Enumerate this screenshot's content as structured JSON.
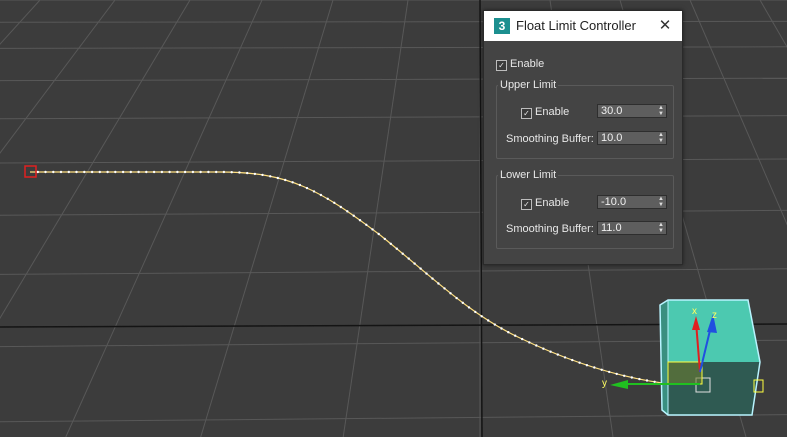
{
  "dialog": {
    "app_icon_glyph": "3",
    "title": "Float Limit Controller",
    "close_glyph": "✕",
    "enable_label": "Enable",
    "enable_checked": true,
    "upper": {
      "title": "Upper Limit",
      "enable_label": "Enable",
      "value": "30.0",
      "smoothing_label": "Smoothing Buffer:",
      "smoothing_value": "10.0"
    },
    "lower": {
      "title": "Lower Limit",
      "enable_label": "Enable",
      "value": "-10.0",
      "smoothing_label": "Smoothing Buffer:",
      "smoothing_value": "11.0"
    }
  },
  "gizmo": {
    "x_label": "x",
    "y_label": "y",
    "z_label": "z"
  },
  "colors": {
    "viewport_bg": "#3c3c3c",
    "grid": "#5a5a5a",
    "axis": "#111111",
    "path": "#ffd060",
    "cube_top": "#4cc9b0",
    "cube_front": "#2f5a52",
    "selection": "#9fe8ff"
  },
  "icons": {
    "app": "3dsmax-icon",
    "close": "close-icon",
    "check": "checkmark-icon",
    "spin": "spinner-arrows-icon"
  }
}
